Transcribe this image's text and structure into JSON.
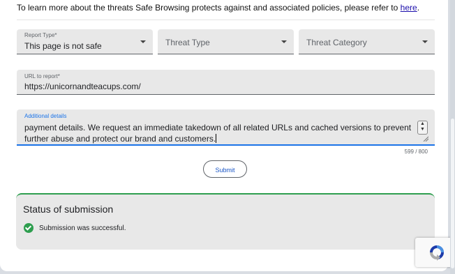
{
  "info": {
    "text": "To learn more about the threats Safe Browsing protects against and associated policies, please refer to ",
    "link": "here",
    "period": "."
  },
  "report_type": {
    "label": "Report Type*",
    "value": "This page is not safe"
  },
  "threat_type": {
    "placeholder": "Threat Type"
  },
  "threat_category": {
    "placeholder": "Threat Category"
  },
  "url_field": {
    "label": "URL to report*",
    "value": "https://unicornandteacups.com/"
  },
  "details": {
    "label": "Additional details",
    "value": "payment details. We request an immediate takedown of all related URLs and cached versions to prevent further abuse and protect our brand and customers.",
    "counter": "599 / 800"
  },
  "submit_label": "Submit",
  "status": {
    "title": "Status of submission",
    "message": "Submission was successful."
  },
  "colors": {
    "success": "#2e9e4f",
    "accent": "#1a73e8"
  }
}
